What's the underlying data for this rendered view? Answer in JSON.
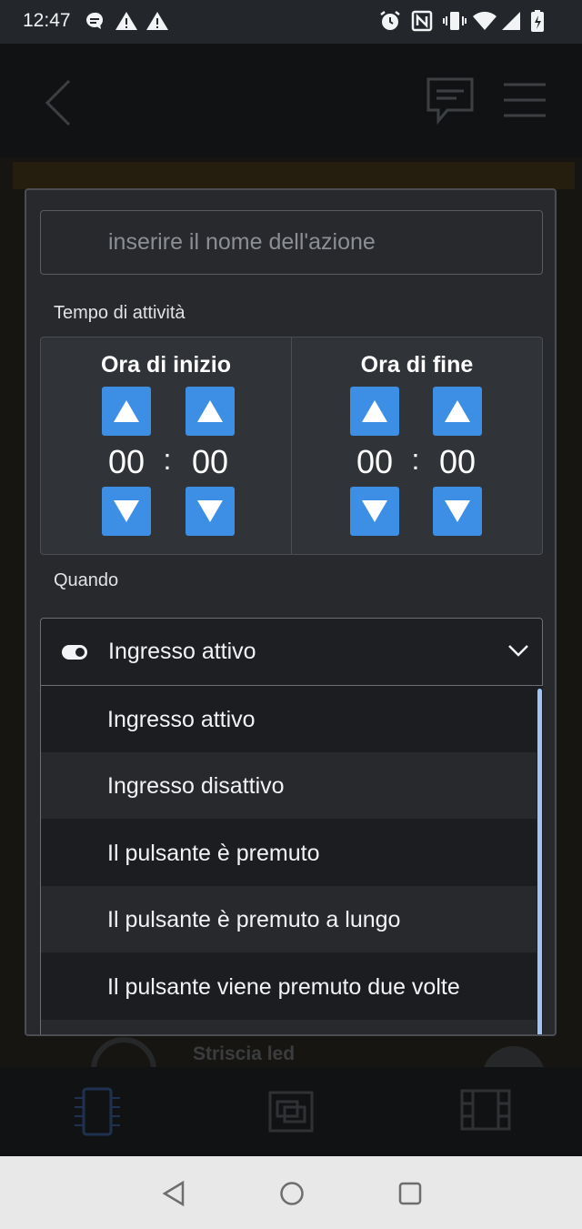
{
  "status_bar": {
    "time": "12:47"
  },
  "modal": {
    "name_input": {
      "placeholder": "inserire il nome dell'azione",
      "value": ""
    },
    "activity_time_label": "Tempo di attività",
    "start": {
      "title": "Ora di inizio",
      "hours": "00",
      "separator": ":",
      "minutes": "00"
    },
    "end": {
      "title": "Ora di fine",
      "hours": "00",
      "separator": ":",
      "minutes": "00"
    },
    "when_label": "Quando",
    "when_select": {
      "selected": "Ingresso attivo",
      "options": [
        "Ingresso attivo",
        "Ingresso disattivo",
        "Il pulsante è premuto",
        "Il pulsante è premuto a lungo",
        "Il pulsante viene premuto due volte"
      ]
    }
  },
  "background": {
    "partial_label": "Striscia led"
  },
  "colors": {
    "accent": "#3d8fe6",
    "modal_bg": "#27292d",
    "scroll_thumb": "#9dc6f6"
  }
}
